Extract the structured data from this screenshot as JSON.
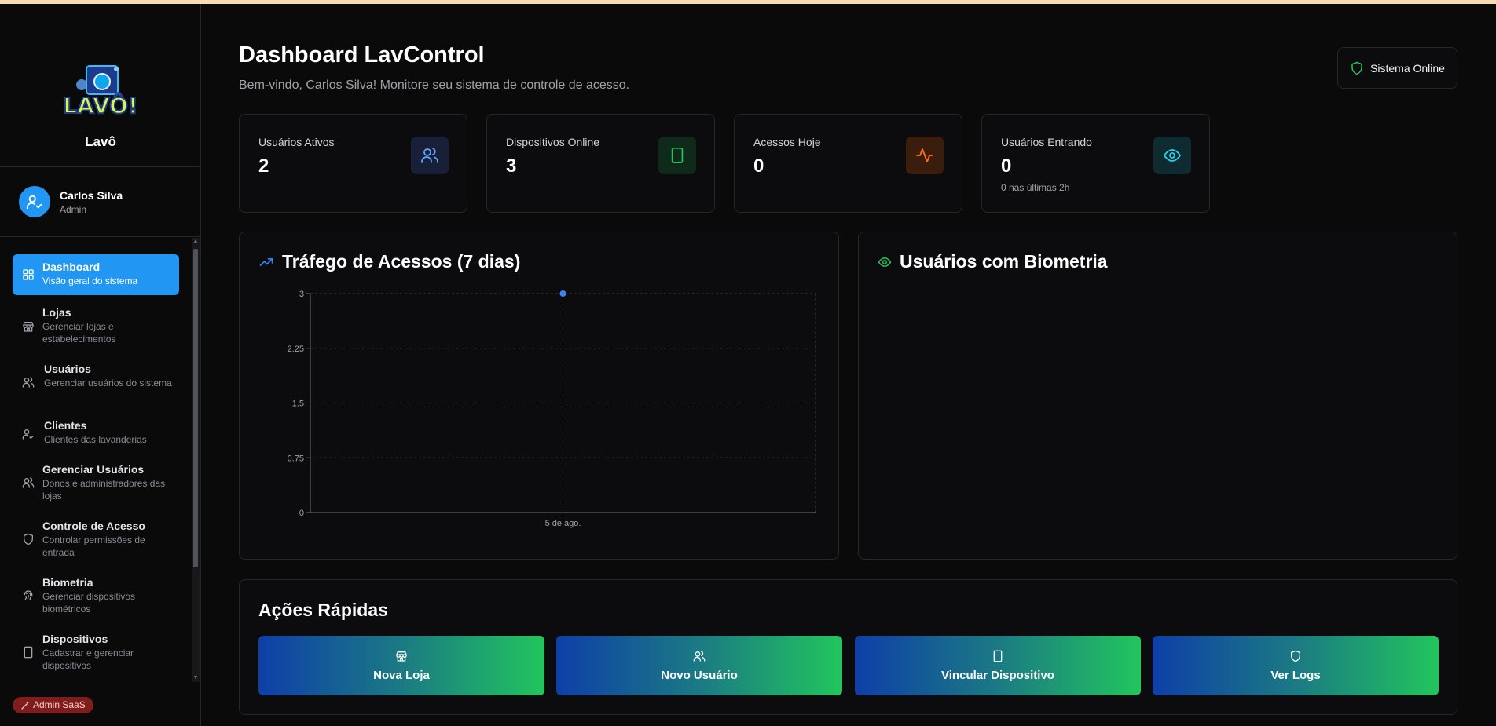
{
  "brand": {
    "name": "Lavô",
    "logo_text": "LAVÔ!"
  },
  "user": {
    "name": "Carlos Silva",
    "role": "Admin"
  },
  "sidebar": {
    "items": [
      {
        "label": "Dashboard",
        "desc": "Visão geral do sistema",
        "icon": "grid-icon",
        "active": true
      },
      {
        "label": "Lojas",
        "desc": "Gerenciar lojas e estabelecimentos",
        "icon": "store-icon"
      },
      {
        "label": "Usuários",
        "desc": "Gerenciar usuários do sistema",
        "icon": "users-icon"
      },
      {
        "label": "Clientes",
        "desc": "Clientes das lavanderias",
        "icon": "user-check-icon"
      },
      {
        "label": "Gerenciar Usuários",
        "desc": "Donos e administradores das lojas",
        "icon": "users-icon"
      },
      {
        "label": "Controle de Acesso",
        "desc": "Controlar permissões de entrada",
        "icon": "shield-icon"
      },
      {
        "label": "Biometria",
        "desc": "Gerenciar dispositivos biométricos",
        "icon": "fingerprint-icon"
      },
      {
        "label": "Dispositivos",
        "desc": "Cadastrar e gerenciar dispositivos",
        "icon": "tablet-icon"
      }
    ],
    "admin_badge": "Admin SaaS"
  },
  "header": {
    "title": "Dashboard LavControl",
    "subtitle": "Bem-vindo, Carlos Silva! Monitore seu sistema de controle de acesso.",
    "status": "Sistema Online"
  },
  "stats": [
    {
      "label": "Usuários Ativos",
      "value": "2",
      "icon": "users-icon",
      "color": "#60a5fa",
      "bg": "#172038"
    },
    {
      "label": "Dispositivos Online",
      "value": "3",
      "icon": "tablet-icon",
      "color": "#22c55e",
      "bg": "#0f2a1a"
    },
    {
      "label": "Acessos Hoje",
      "value": "0",
      "icon": "activity-icon",
      "color": "#f97316",
      "bg": "#3a1d0c"
    },
    {
      "label": "Usuários Entrando",
      "value": "0",
      "sub": "0 nas últimas 2h",
      "icon": "eye-icon",
      "color": "#22d3ee",
      "bg": "#0f2a30"
    }
  ],
  "traffic": {
    "title": "Tráfego de Acessos (7 dias)",
    "icon": "trending-up-icon"
  },
  "biometry": {
    "title": "Usuários com Biometria",
    "icon": "eye-icon"
  },
  "chart_data": {
    "type": "line",
    "title": "Tráfego de Acessos (7 dias)",
    "x": [
      "5 de ago."
    ],
    "y_ticks": [
      "0",
      "0.75",
      "1.5",
      "2.25",
      "3"
    ],
    "series": [
      {
        "values": [
          3
        ]
      }
    ],
    "ylim": [
      0,
      3
    ],
    "grid": true,
    "color": "#3b82f6"
  },
  "quick_actions": {
    "title": "Ações Rápidas",
    "buttons": [
      {
        "label": "Nova Loja",
        "icon": "store-icon"
      },
      {
        "label": "Novo Usuário",
        "icon": "users-icon"
      },
      {
        "label": "Vincular Dispositivo",
        "icon": "tablet-icon"
      },
      {
        "label": "Ver Logs",
        "icon": "shield-icon"
      }
    ]
  }
}
